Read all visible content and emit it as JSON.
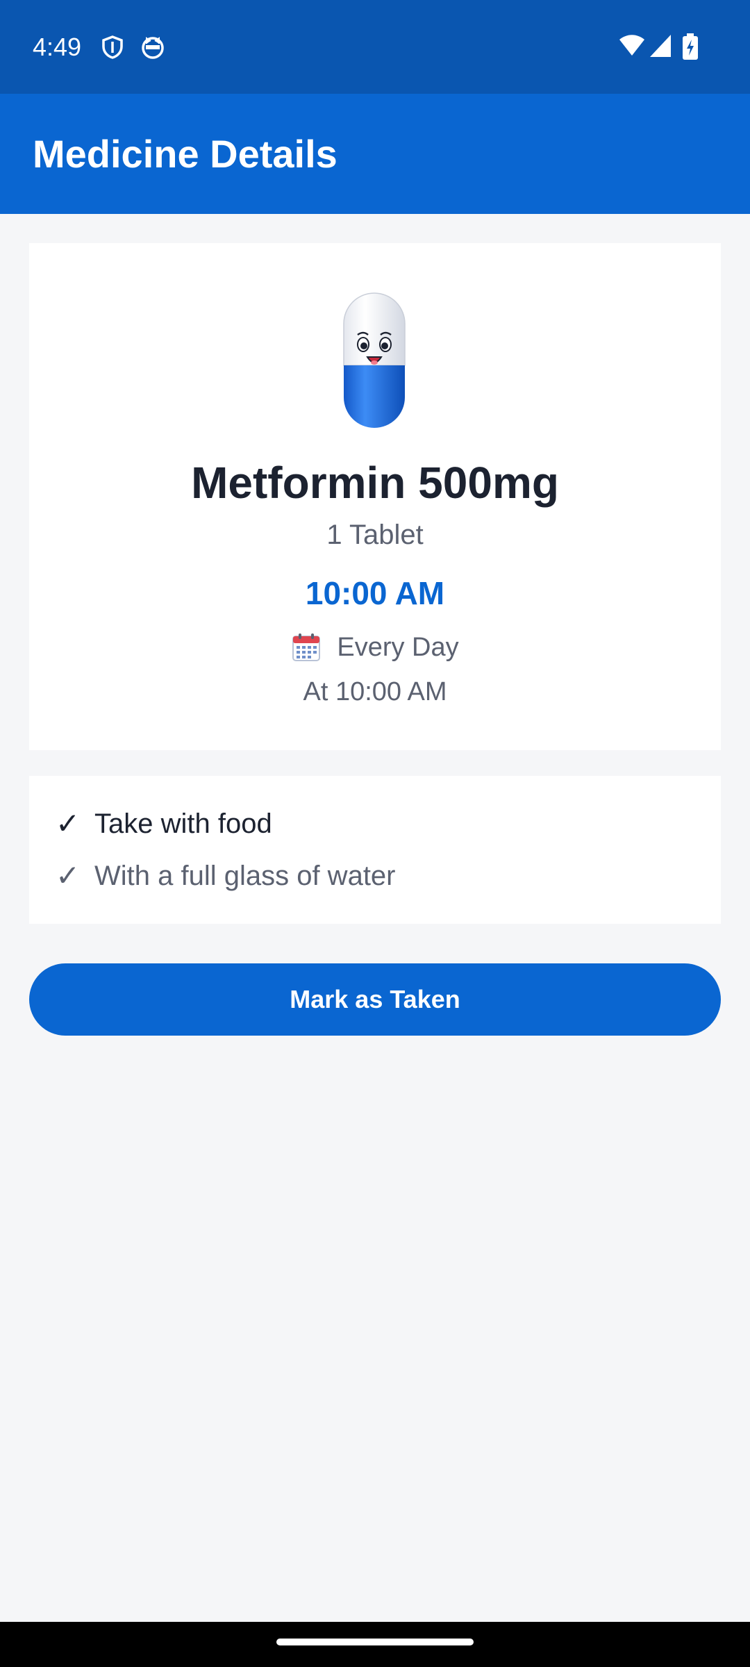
{
  "status_bar": {
    "time": "4:49",
    "icons": [
      "shield-icon",
      "cat-face-icon",
      "wifi-icon",
      "signal-icon",
      "battery-charging-icon"
    ]
  },
  "app_bar": {
    "title": "Medicine Details"
  },
  "medicine": {
    "icon": "smiling-pill-icon",
    "name": "Metformin 500mg",
    "dose": "1 Tablet",
    "time": "10:00 AM",
    "frequency_icon": "calendar-icon",
    "frequency": "Every Day",
    "frequency_detail": "At 10:00 AM"
  },
  "notes": {
    "check_glyph": "✓",
    "items": [
      "Take with food",
      "With a full glass of water"
    ]
  },
  "actions": {
    "mark_taken_label": "Mark as Taken"
  },
  "colors": {
    "status_bar": "#0a56b0",
    "primary": "#0a66d1",
    "background": "#f5f6f8",
    "text_dark": "#1c2230",
    "text_muted": "#5b6170"
  }
}
